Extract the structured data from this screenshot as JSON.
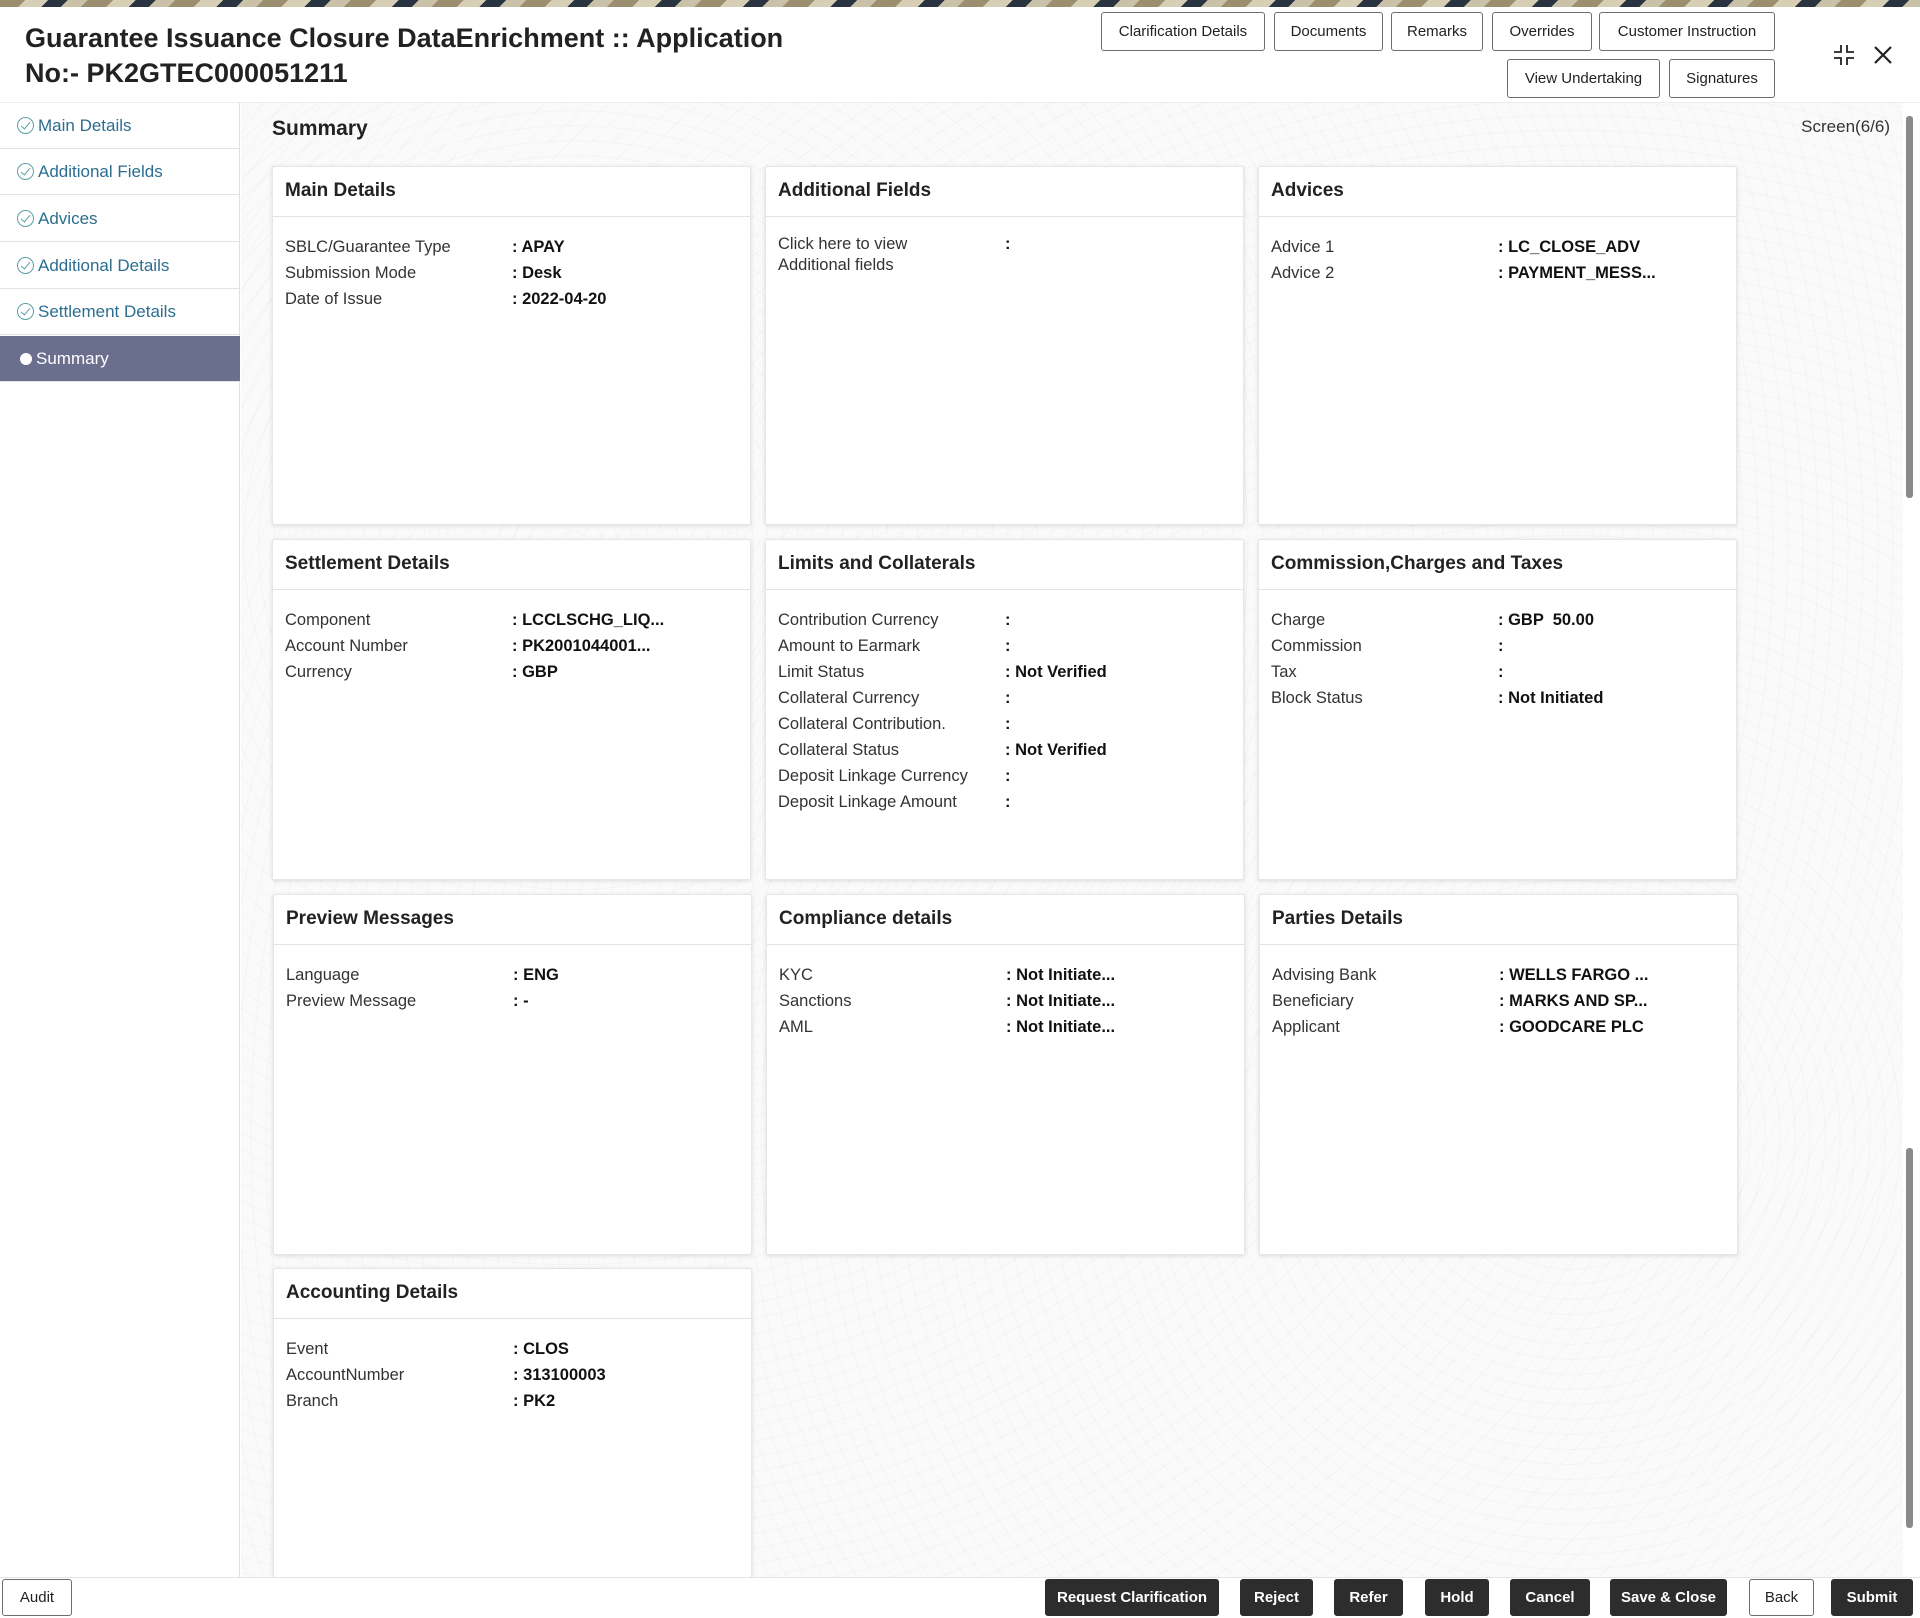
{
  "header": {
    "title": "Guarantee Issuance Closure DataEnrichment :: Application No:- PK2GTEC000051211",
    "buttons": {
      "clarification": "Clarification Details",
      "documents": "Documents",
      "remarks": "Remarks",
      "overrides": "Overrides",
      "customer_instruction": "Customer Instruction",
      "view_undertaking": "View Undertaking",
      "signatures": "Signatures"
    },
    "icons": {
      "minimize": "⤡",
      "close": "✕"
    }
  },
  "sidebar": {
    "items": [
      {
        "label": "Main Details"
      },
      {
        "label": "Additional Fields"
      },
      {
        "label": "Advices"
      },
      {
        "label": "Additional Details"
      },
      {
        "label": "Settlement Details"
      },
      {
        "label": "Summary"
      }
    ]
  },
  "main": {
    "title": "Summary",
    "screen": "Screen(6/6)"
  },
  "cards": {
    "main_details": {
      "title": "Main Details",
      "rows": [
        {
          "k": "SBLC/Guarantee Type",
          "v": ": APAY"
        },
        {
          "k": "Submission Mode",
          "v": ": Desk"
        },
        {
          "k": "Date of Issue",
          "v": ": 2022-04-20"
        }
      ]
    },
    "additional_fields": {
      "title": "Additional Fields",
      "rows": [
        {
          "k": "Click here to view Additional fields",
          "v": ":"
        }
      ]
    },
    "advices": {
      "title": "Advices",
      "rows": [
        {
          "k": "Advice 1",
          "v": ": LC_CLOSE_ADV"
        },
        {
          "k": "Advice 2",
          "v": ": PAYMENT_MESS..."
        }
      ]
    },
    "settlement": {
      "title": "Settlement Details",
      "rows": [
        {
          "k": "Component",
          "v": ": LCCLSCHG_LIQ..."
        },
        {
          "k": "Account Number",
          "v": ": PK2001044001..."
        },
        {
          "k": "Currency",
          "v": ": GBP"
        }
      ]
    },
    "limits": {
      "title": "Limits and Collaterals",
      "rows": [
        {
          "k": "Contribution Currency",
          "v": ":"
        },
        {
          "k": "Amount to Earmark",
          "v": ":"
        },
        {
          "k": "Limit Status",
          "v": ": Not Verified"
        },
        {
          "k": "Collateral Currency",
          "v": ":"
        },
        {
          "k": "Collateral Contribution.",
          "v": ":"
        },
        {
          "k": "Collateral Status",
          "v": ": Not Verified"
        },
        {
          "k": "Deposit Linkage Currency",
          "v": ":"
        },
        {
          "k": "Deposit Linkage Amount",
          "v": ":"
        }
      ]
    },
    "commission": {
      "title": "Commission,Charges and Taxes",
      "rows": [
        {
          "k": "Charge",
          "v": ": GBP  50.00"
        },
        {
          "k": "Commission",
          "v": ":"
        },
        {
          "k": "Tax",
          "v": ":"
        },
        {
          "k": "Block Status",
          "v": ": Not Initiated"
        }
      ]
    },
    "preview": {
      "title": "Preview Messages",
      "rows": [
        {
          "k": "Language",
          "v": ": ENG"
        },
        {
          "k": "Preview Message",
          "v": ": -"
        }
      ]
    },
    "compliance": {
      "title": "Compliance details",
      "rows": [
        {
          "k": "KYC",
          "v": ": Not Initiate..."
        },
        {
          "k": "Sanctions",
          "v": ": Not Initiate..."
        },
        {
          "k": "AML",
          "v": ": Not Initiate..."
        }
      ]
    },
    "parties": {
      "title": "Parties Details",
      "rows": [
        {
          "k": "Advising Bank",
          "v": ": WELLS FARGO ..."
        },
        {
          "k": "Beneficiary",
          "v": ": MARKS AND SP..."
        },
        {
          "k": "Applicant",
          "v": ": GOODCARE PLC"
        }
      ]
    },
    "accounting": {
      "title": "Accounting Details",
      "rows": [
        {
          "k": "Event",
          "v": ": CLOS"
        },
        {
          "k": "AccountNumber",
          "v": ": 313100003"
        },
        {
          "k": "Branch",
          "v": ": PK2"
        }
      ]
    }
  },
  "footer": {
    "audit": "Audit",
    "request_clarification": "Request Clarification",
    "reject": "Reject",
    "refer": "Refer",
    "hold": "Hold",
    "cancel": "Cancel",
    "save_close": "Save & Close",
    "back": "Back",
    "submit": "Submit"
  }
}
